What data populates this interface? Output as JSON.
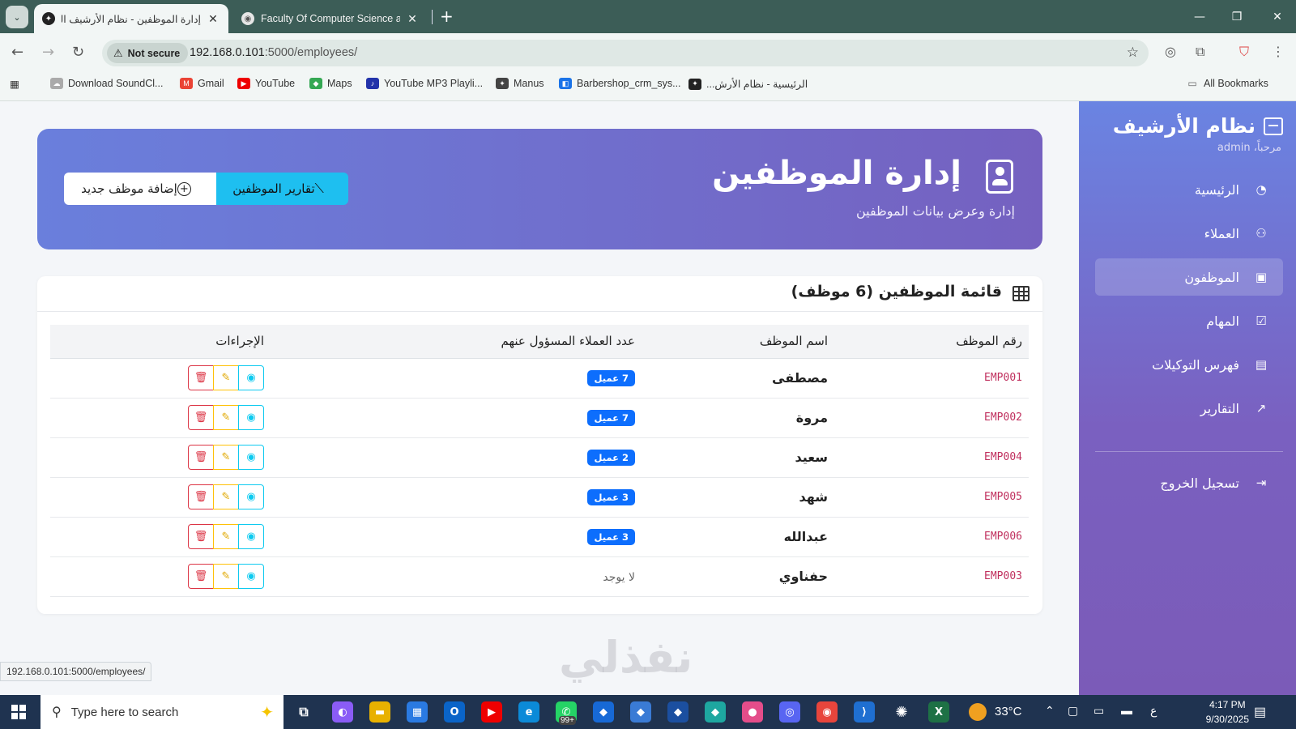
{
  "browser": {
    "tabs": [
      {
        "title": "إدارة الموظفين - نظام الأرشيف الـ",
        "active": true
      },
      {
        "title": "Faculty Of Computer Science an",
        "active": false
      }
    ],
    "security_label": "Not secure",
    "url_host": "192.168.0.101",
    "url_path": ":5000/employees/",
    "bookmarks": [
      {
        "label": "Download SoundCl...",
        "icon": "cloud-icon"
      },
      {
        "label": "Gmail",
        "icon": "gmail-icon"
      },
      {
        "label": "YouTube",
        "icon": "youtube-icon"
      },
      {
        "label": "Maps",
        "icon": "maps-icon"
      },
      {
        "label": "YouTube MP3 Playli...",
        "icon": "music-icon"
      },
      {
        "label": "Manus",
        "icon": "manus-icon"
      },
      {
        "label": "Barbershop_crm_sys...",
        "icon": "app-icon"
      },
      {
        "label": "الرئيسية - نظام الأرش...",
        "icon": "archive-icon"
      }
    ],
    "all_bookmarks": "All Bookmarks",
    "status_url": "192.168.0.101:5000/employees/"
  },
  "sidebar": {
    "brand": "نظام الأرشيف",
    "welcome": "مرحباً، admin",
    "items": [
      {
        "label": "الرئيسية",
        "icon": "dashboard-icon"
      },
      {
        "label": "العملاء",
        "icon": "users-icon"
      },
      {
        "label": "الموظفون",
        "icon": "id-badge-icon"
      },
      {
        "label": "المهام",
        "icon": "check-square-icon"
      },
      {
        "label": "فهرس التوكيلات",
        "icon": "document-icon"
      },
      {
        "label": "التقارير",
        "icon": "chart-icon"
      }
    ],
    "logout": "تسجيل الخروج"
  },
  "header": {
    "title": "إدارة الموظفين",
    "subtitle": "إدارة وعرض بيانات الموظفين",
    "add_button": "إضافة موظف جديد",
    "reports_button": "تقارير الموظفين"
  },
  "list": {
    "title": "قائمة الموظفين (6 موظف)",
    "columns": [
      "رقم الموظف",
      "اسم الموظف",
      "عدد العملاء المسؤول عنهم",
      "الإجراءات"
    ],
    "rows": [
      {
        "id": "EMP001",
        "name": "مصطفى",
        "clients": "7 عميل"
      },
      {
        "id": "EMP002",
        "name": "مروة",
        "clients": "7 عميل"
      },
      {
        "id": "EMP004",
        "name": "سعيد",
        "clients": "2 عميل"
      },
      {
        "id": "EMP005",
        "name": "شهد",
        "clients": "3 عميل"
      },
      {
        "id": "EMP006",
        "name": "عبدالله",
        "clients": "3 عميل"
      },
      {
        "id": "EMP003",
        "name": "حفناوي",
        "clients": "لا يوجد"
      }
    ]
  },
  "watermark": "نفذلي",
  "taskbar": {
    "search_placeholder": "Type here to search",
    "weather": "33°C",
    "lang": "ع",
    "time": "4:17 PM",
    "date": "9/30/2025",
    "badge": "99+"
  },
  "colors": {
    "sidebar_top": "#6a84e2",
    "sidebar_bottom": "#7b5bb8",
    "badge": "#0d6efd",
    "reports_button": "#1ebff0",
    "employee_id": "#c0305e"
  }
}
